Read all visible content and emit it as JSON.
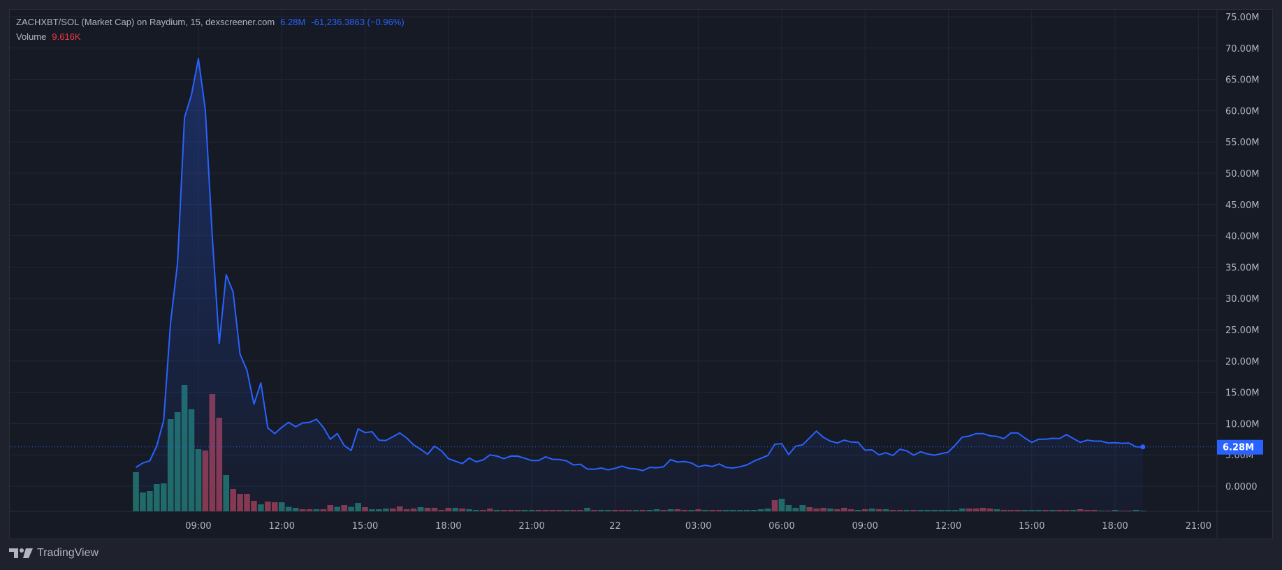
{
  "legend": {
    "title": "ZACHXBT/SOL (Market Cap) on Raydium, 15, dexscreener.com",
    "last_value": "6.28M",
    "change": "-61,236.3863 (−0.96%)",
    "volume_label": "Volume",
    "volume_value": "9.616K"
  },
  "branding": {
    "logo_text": "TradingView"
  },
  "colors": {
    "line": "#2962ff",
    "up_volume": "#1f6b63",
    "down_volume": "#89374a",
    "grid": "#232734",
    "axis_text": "#b2b5be"
  },
  "chart_data": {
    "type": "area",
    "title": "ZACHXBT/SOL (Market Cap)",
    "interval_minutes": 15,
    "start_time": "06:45",
    "ylabel": "Market Cap (M)",
    "ylim": [
      0,
      75
    ],
    "y_ticks": [
      {
        "value": 75,
        "label": "75.00M"
      },
      {
        "value": 70,
        "label": "70.00M"
      },
      {
        "value": 65,
        "label": "65.00M"
      },
      {
        "value": 60,
        "label": "60.00M"
      },
      {
        "value": 55,
        "label": "55.00M"
      },
      {
        "value": 50,
        "label": "50.00M"
      },
      {
        "value": 45,
        "label": "45.00M"
      },
      {
        "value": 40,
        "label": "40.00M"
      },
      {
        "value": 35,
        "label": "35.00M"
      },
      {
        "value": 30,
        "label": "30.00M"
      },
      {
        "value": 25,
        "label": "25.00M"
      },
      {
        "value": 20,
        "label": "20.00M"
      },
      {
        "value": 15,
        "label": "15.00M"
      },
      {
        "value": 10,
        "label": "10.00M"
      },
      {
        "value": 5,
        "label": "5.00M"
      },
      {
        "value": 0,
        "label": "0.0000"
      }
    ],
    "x_ticks": [
      {
        "candle": 9,
        "label": "09:00"
      },
      {
        "candle": 21,
        "label": "12:00"
      },
      {
        "candle": 33,
        "label": "15:00"
      },
      {
        "candle": 45,
        "label": "18:00"
      },
      {
        "candle": 57,
        "label": "21:00"
      },
      {
        "candle": 69,
        "label": "22"
      },
      {
        "candle": 81,
        "label": "03:00"
      },
      {
        "candle": 93,
        "label": "06:00"
      },
      {
        "candle": 105,
        "label": "09:00"
      },
      {
        "candle": 117,
        "label": "12:00"
      },
      {
        "candle": 129,
        "label": "15:00"
      },
      {
        "candle": 141,
        "label": "18:00"
      },
      {
        "candle": 153,
        "label": "21:00"
      }
    ],
    "last_price": {
      "value": 6.28,
      "label": "6.28M"
    },
    "series": [
      {
        "name": "Market Cap (M)",
        "values": [
          3.0,
          3.7,
          4.05,
          6.4,
          10.5,
          26.2,
          35.6,
          58.9,
          62.5,
          68.3,
          60.1,
          40.0,
          22.8,
          33.8,
          31.0,
          21.1,
          18.5,
          13.1,
          16.5,
          9.3,
          8.4,
          9.4,
          10.2,
          9.5,
          10.1,
          10.2,
          10.7,
          9.4,
          7.5,
          8.4,
          6.5,
          5.7,
          9.15,
          8.55,
          8.7,
          7.35,
          7.3,
          7.9,
          8.5,
          7.7,
          6.6,
          5.9,
          5.1,
          6.4,
          5.65,
          4.4,
          4.0,
          3.6,
          4.5,
          3.9,
          4.2,
          5.0,
          4.8,
          4.4,
          4.8,
          4.8,
          4.45,
          4.1,
          4.1,
          4.7,
          4.3,
          4.25,
          4.05,
          3.4,
          3.5,
          2.75,
          2.7,
          2.9,
          2.6,
          2.85,
          3.2,
          2.85,
          2.75,
          2.5,
          3.0,
          2.95,
          3.1,
          4.25,
          3.85,
          3.95,
          3.7,
          3.1,
          3.35,
          3.15,
          3.55,
          3.0,
          2.9,
          3.1,
          3.4,
          4.0,
          4.45,
          4.9,
          6.7,
          6.8,
          5.05,
          6.4,
          6.6,
          7.7,
          8.8,
          7.8,
          7.2,
          6.9,
          7.35,
          7.05,
          7.0,
          5.75,
          5.8,
          5.0,
          5.35,
          4.9,
          5.9,
          5.65,
          4.95,
          5.5,
          5.15,
          4.95,
          5.2,
          5.45,
          6.6,
          7.85,
          8.0,
          8.4,
          8.4,
          8.05,
          7.95,
          7.6,
          8.5,
          8.5,
          7.7,
          7.0,
          7.5,
          7.5,
          7.65,
          7.6,
          8.25,
          7.6,
          7.0,
          7.35,
          7.2,
          7.2,
          6.9,
          6.95,
          6.85,
          6.9,
          6.3,
          6.28
        ]
      }
    ],
    "volume": {
      "unit": "relative",
      "values": [
        56,
        27,
        29,
        39,
        40,
        132,
        142,
        181,
        146,
        89,
        87,
        168,
        134,
        52,
        32,
        25,
        25,
        15,
        10,
        14,
        13,
        13,
        6.5,
        5,
        3,
        3,
        3,
        3,
        9,
        6.5,
        9,
        6.5,
        12,
        6,
        3,
        3,
        4,
        4,
        7,
        3,
        4,
        6,
        5,
        5,
        2,
        5,
        5,
        4,
        3,
        2,
        2,
        4,
        2,
        2,
        2,
        2,
        2,
        2,
        2,
        2,
        2,
        2,
        2,
        2,
        2,
        5,
        2,
        2,
        2,
        2,
        2,
        2,
        2,
        2,
        2,
        3,
        2,
        3,
        3,
        2,
        2,
        3,
        2,
        2,
        2,
        2,
        2,
        2,
        2,
        2,
        3,
        4,
        16,
        18,
        9,
        5,
        9,
        6,
        4,
        5,
        4,
        3,
        5,
        3,
        2,
        3,
        4,
        3,
        3,
        2,
        2,
        2,
        2,
        2,
        2,
        2,
        2,
        2,
        2,
        4,
        4,
        4,
        5,
        4,
        3,
        2,
        2,
        2,
        2,
        2,
        2,
        2,
        2,
        2,
        2,
        2,
        3,
        2,
        2,
        1,
        1,
        2,
        1,
        1,
        2,
        1
      ],
      "direction": "gggggggggg rrrgrrrrgrrgggrrgrr grggrgggrrrrgrrrrgrggrrgrrrggrrrrgrrgrggrr rgrggrgrrgrgrrgggggggrggggrrrgrrrgrgrgrrg rgggggggrrrrgrrrgggrgrrgrrrgrgrr"
    }
  }
}
